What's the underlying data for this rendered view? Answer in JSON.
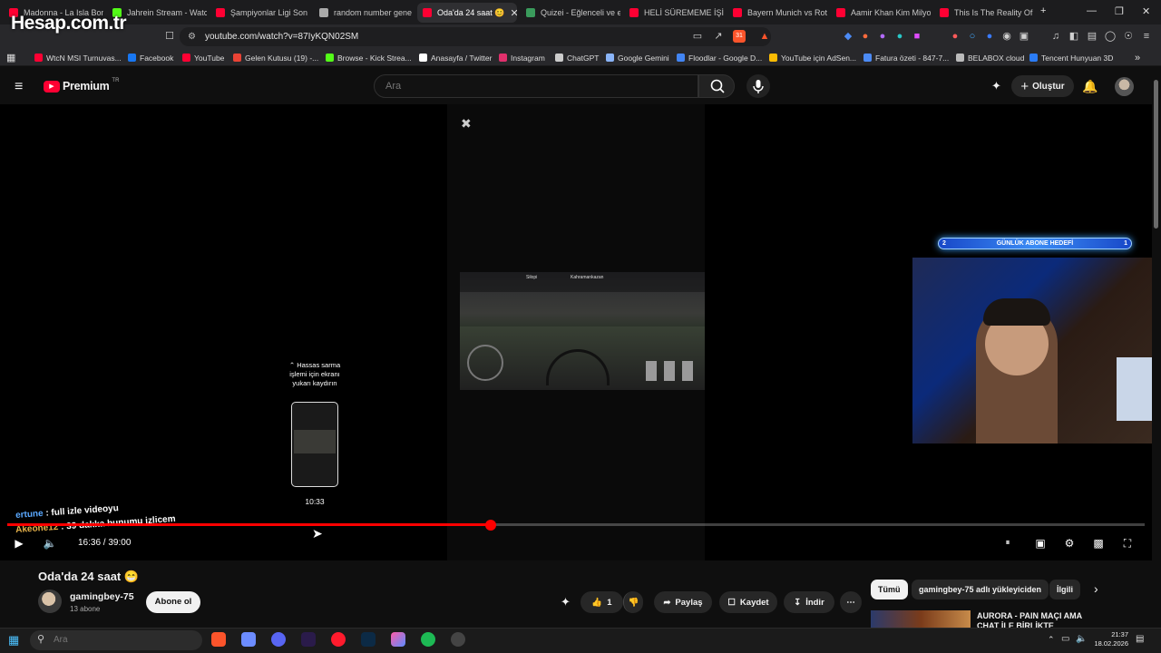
{
  "browser": {
    "tabs": [
      {
        "title": "Madonna - La Isla Bon",
        "color": "#ff0033"
      },
      {
        "title": "Jahrein Stream - Watc",
        "color": "#53fc18"
      },
      {
        "title": "Şampiyonlar Ligi Son",
        "color": "#ff0033"
      },
      {
        "title": "random number gene",
        "color": "#aaaaaa"
      },
      {
        "title": "Oda'da 24 saat 😊",
        "color": "#ff0033",
        "active": true
      },
      {
        "title": "Quizei - Eğlenceli ve e",
        "color": "#3a9b5c"
      },
      {
        "title": "HELİ SÜREMEME İŞİ | S",
        "color": "#ff0033"
      },
      {
        "title": "Bayern Munich vs Rott",
        "color": "#ff0033"
      },
      {
        "title": "Aamir Khan Kim Milyo",
        "color": "#ff0033"
      },
      {
        "title": "This Is The Reality Of M",
        "color": "#ff0033"
      }
    ],
    "new_tab": "+",
    "url": "youtube.com/watch?v=87IyKQN02SM",
    "bookmarks": [
      {
        "label": "WtcN MSI Turnuvas...",
        "color": "#ff0033"
      },
      {
        "label": "Facebook",
        "color": "#1877f2"
      },
      {
        "label": "YouTube",
        "color": "#ff0033"
      },
      {
        "label": "Gelen Kutusu (19) -...",
        "color": "#ea4335"
      },
      {
        "label": "Browse - Kick Strea...",
        "color": "#53fc18"
      },
      {
        "label": "Anasayfa / Twitter",
        "color": "#ffffff"
      },
      {
        "label": "Instagram",
        "color": "#e1306c"
      },
      {
        "label": "ChatGPT",
        "color": "#cccccc"
      },
      {
        "label": "Google Gemini",
        "color": "#8ab4f8"
      },
      {
        "label": "Floodlar - Google D...",
        "color": "#4285f4"
      },
      {
        "label": "YouTube için AdSen...",
        "color": "#fbbc04"
      },
      {
        "label": "Fatura özeti - 847-7...",
        "color": "#4c8bf5"
      },
      {
        "label": "BELABOX cloud",
        "color": "#bbbbbb"
      },
      {
        "label": "Tencent Hunyuan 3D",
        "color": "#2b7cf5"
      }
    ],
    "shield_count": "31"
  },
  "watermark": "Hesap.com.tr",
  "youtube": {
    "logo_text": "Premium",
    "logo_region": "TR",
    "search_placeholder": "Ara",
    "create_label": "Oluştur",
    "player": {
      "current_time": "16:36",
      "duration": "39:00",
      "time_label": "16:36 / 39:00",
      "progress_fraction": 0.425,
      "preview_hint": "⌃ Hassas sarma işlemi için ekranı yukarı kaydırın",
      "preview_time": "10:33",
      "overlay_goal": {
        "left": "2",
        "label": "GÜNLÜK ABONE HEDEFİ",
        "right": "1"
      },
      "chat": [
        {
          "user": "ertune",
          "message": " : full izle videoyu"
        },
        {
          "user": "Akeone12",
          "message": " : 39 dakka bunumu izlicem"
        }
      ],
      "game_hud": {
        "left_label": "Silopi",
        "right_label": "Kahramankazan"
      }
    },
    "video_title": "Oda'da 24 saat 😁",
    "channel": {
      "name": "gamingbey-75",
      "subscribers": "13 abone",
      "subscribe_label": "Abone ol"
    },
    "actions": {
      "like_count": "1",
      "share": "Paylaş",
      "save": "Kaydet",
      "download": "İndir"
    },
    "chips": [
      {
        "label": "Tümü",
        "selected": true
      },
      {
        "label": "gamingbey-75 adlı yükleyiciden"
      },
      {
        "label": "İlgili"
      }
    ],
    "related": {
      "title": "AURORA - PAIN MAÇI AMA CHAT İLE BİRLİKTE"
    }
  },
  "taskbar": {
    "search_placeholder": "Ara",
    "time": "21:37",
    "date": "18.02.2026"
  }
}
